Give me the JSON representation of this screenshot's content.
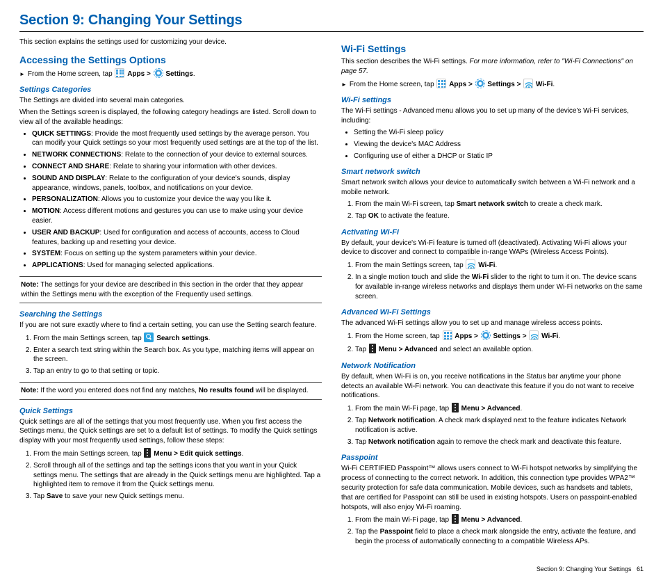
{
  "section_title": "Section 9: Changing Your Settings",
  "intro": "This section explains the settings used for customizing your device.",
  "footer": {
    "label": "Section 9:  Changing Your Settings",
    "page": "61"
  },
  "left": {
    "accessing": {
      "title": "Accessing the Settings Options",
      "line_pre": "From the Home screen, tap",
      "apps_label": "Apps >",
      "settings_label": "Settings",
      "dot": "."
    },
    "categories": {
      "title": "Settings Categories",
      "p1": "The Settings are divided into several main categories.",
      "p2": "When the Settings screen is displayed, the following category headings are listed. Scroll down to view all of the available headings:",
      "items": [
        {
          "name": "QUICK SETTINGS",
          "desc": ": Provide the most frequently used settings by the average person. You can modify your Quick settings so your most frequently used settings are at the top of the list."
        },
        {
          "name": "NETWORK CONNECTIONS",
          "desc": ": Relate to the connection of your device to external sources."
        },
        {
          "name": "CONNECT AND SHARE",
          "desc": ": Relate to sharing your information with other devices."
        },
        {
          "name": "SOUND AND DISPLAY",
          "desc": ": Relate to the configuration of your device's sounds, display appearance, windows, panels, toolbox, and notifications on your device."
        },
        {
          "name": "PERSONALIZATION",
          "desc": ": Allows you to customize your device the way you like it."
        },
        {
          "name": "MOTION",
          "desc": ": Access different motions and gestures you can use to make using your device easier."
        },
        {
          "name": "USER AND BACKUP",
          "desc": ": Used for configuration and access of accounts, access to Cloud features, backing up and resetting your device."
        },
        {
          "name": "SYSTEM",
          "desc": ": Focus on setting up the system parameters within your device."
        },
        {
          "name": "APPLICATIONS",
          "desc": ": Used for managing selected applications."
        }
      ],
      "note": "The settings for your device are described in this section in the order that they appear within the Settings menu with the exception of the Frequently used settings."
    },
    "searching": {
      "title": "Searching the Settings",
      "p1": "If you are not sure exactly where to find a certain setting, you can use the Setting search feature.",
      "step1_pre": "From the main Settings screen, tap",
      "step1_post": "Search settings",
      "step2": "Enter a search text string within the Search box. As you type, matching items will appear on the screen.",
      "step3": "Tap an entry to go to that setting or topic.",
      "note_pre": "If the word you entered does not find any matches, ",
      "note_bold": "No results found",
      "note_post": " will be displayed."
    },
    "quick": {
      "title": "Quick Settings",
      "p1": "Quick settings are all of the settings that you most frequently use. When you first access the Settings menu, the Quick settings are set to a default list of settings. To modify the Quick settings display with your most frequently used settings, follow these steps:",
      "step1_pre": "From the main Settings screen, tap",
      "step1_menu": "Menu > Edit quick settings",
      "step2": "Scroll through all of the settings and tap the settings icons that you want in your Quick settings menu. The settings that are already in the Quick settings menu are highlighted. Tap a highlighted item to remove it from the Quick settings menu.",
      "step3_pre": "Tap ",
      "step3_bold": "Save",
      "step3_post": " to save your new Quick settings menu."
    }
  },
  "right": {
    "wifi": {
      "title": "Wi-Fi Settings",
      "intro_pre": "This section describes the Wi-Fi settings. ",
      "intro_italic": "For more information, refer to \"Wi-Fi Connections\" on page 57.",
      "line_pre": "From the Home screen, tap",
      "apps_label": "Apps >",
      "settings_label": "Settings >",
      "wifi_label": "Wi-Fi",
      "dot": "."
    },
    "wifi_settings_sub": {
      "title": "Wi-Fi settings",
      "p1": "The Wi-Fi settings - Advanced menu allows you to set up many of the device's Wi-Fi services, including:",
      "items": [
        "Setting the Wi-Fi sleep policy",
        "Viewing the device's MAC Address",
        "Configuring use of either a DHCP or Static IP"
      ]
    },
    "smart": {
      "title": "Smart network switch",
      "p1": "Smart network switch allows your device to automatically switch between a Wi-Fi network and a mobile network.",
      "step1_pre": "From the main Wi-Fi screen, tap ",
      "step1_bold": "Smart network switch",
      "step1_post": " to create a check mark.",
      "step2_pre": "Tap ",
      "step2_bold": "OK",
      "step2_post": " to activate the feature."
    },
    "activating": {
      "title": "Activating Wi-Fi",
      "p1": "By default, your device's Wi-Fi feature is turned off (deactivated). Activating Wi-Fi allows your device to discover and connect to compatible in-range WAPs (Wireless Access Points).",
      "step1_pre": "From the main Settings screen, tap",
      "step1_label": "Wi-Fi",
      "step2_pre": "In a single motion touch and slide the ",
      "step2_bold": "Wi-Fi",
      "step2_post": " slider to the right to turn it on. The device scans for available in-range wireless networks and displays them under Wi-Fi networks on the same screen."
    },
    "advanced": {
      "title": "Advanced Wi-Fi Settings",
      "p1": "The advanced Wi-Fi settings allow you to set up and manage wireless access points.",
      "step1_pre": "From the Home screen, tap",
      "apps_label": "Apps >",
      "settings_label": "Settings >",
      "wifi_label": "Wi-Fi",
      "step2_pre": "Tap",
      "step2_menu": "Menu > Advanced",
      "step2_post": " and select an available option."
    },
    "notification": {
      "title": "Network Notification",
      "p1": "By default, when Wi-Fi is on, you receive notifications in the Status bar anytime your phone detects an available Wi-Fi network. You can deactivate this feature if you do not want to receive notifications.",
      "step1_pre": "From the main Wi-Fi page, tap",
      "step1_menu": "Menu > Advanced",
      "step2_pre": "Tap ",
      "step2_bold": "Network notification",
      "step2_post": ". A check mark displayed next to the feature indicates Network notification is active.",
      "step3_pre": "Tap ",
      "step3_bold": "Network notification",
      "step3_post": " again to remove the check mark and deactivate this feature."
    },
    "passpoint": {
      "title": "Passpoint",
      "p1": "Wi-Fi CERTIFIED Passpoint™ allows users connect to Wi-Fi hotspot networks by simplifying the process of connecting to the correct network. In addition, this connection type provides WPA2™ security protection for safe data communication. Mobile devices, such as handsets and tablets, that are certified for Passpoint can still be used in existing hotspots. Users on passpoint-enabled hotspots, will also enjoy Wi-Fi roaming.",
      "step1_pre": "From the main Wi-Fi page, tap",
      "step1_menu": "Menu > Advanced",
      "step2_pre": "Tap the ",
      "step2_bold": "Passpoint",
      "step2_post": " field to place a check mark alongside the entry, activate the feature, and begin the process of automatically connecting to a compatible Wireless APs."
    }
  }
}
